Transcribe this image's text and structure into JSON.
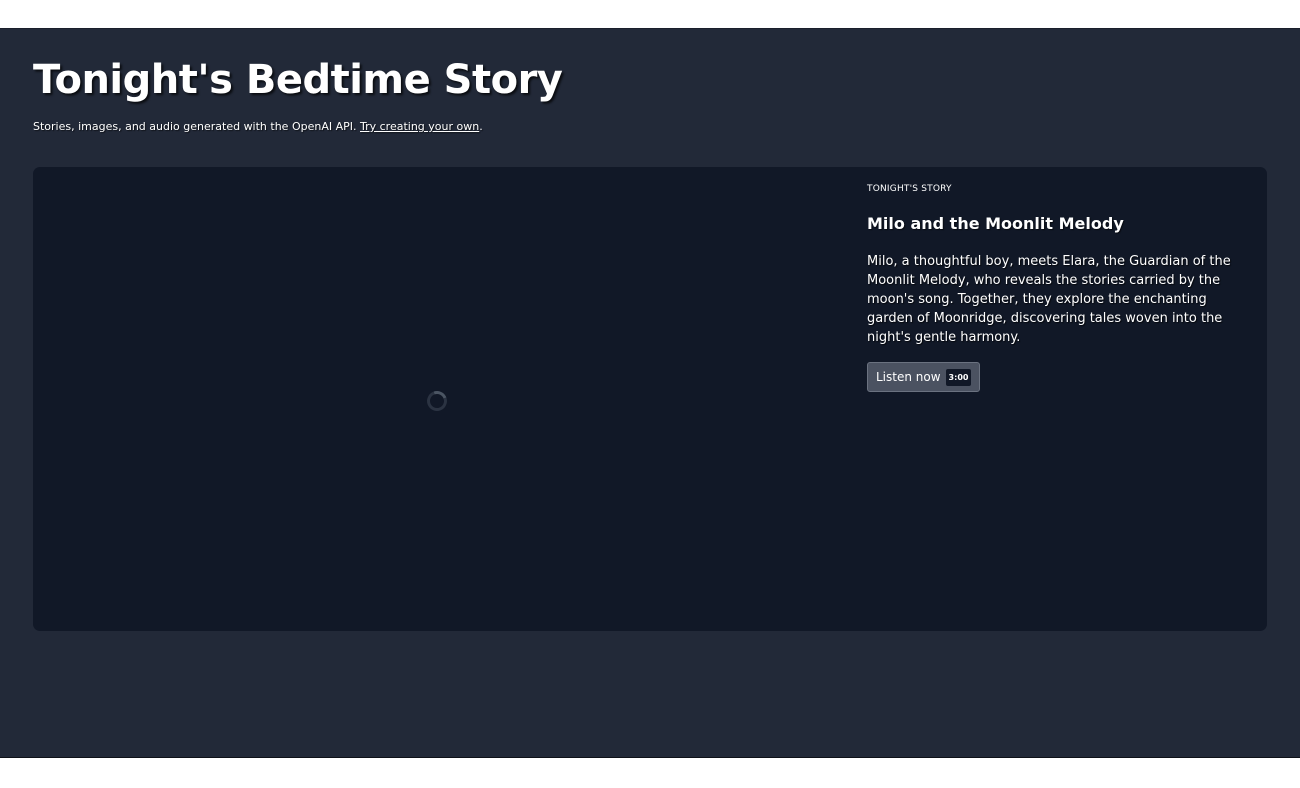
{
  "header": {
    "title": "Tonight's Bedtime Story",
    "subtitle_prefix": "Stories, images, and audio generated with the OpenAI API. ",
    "subtitle_link": "Try creating your own",
    "subtitle_suffix": "."
  },
  "story": {
    "eyebrow": "TONIGHT'S STORY",
    "title": "Milo and the Moonlit Melody",
    "description": "Milo, a thoughtful boy, meets Elara, the Guardian of the Moonlit Melody, who reveals the stories carried by the moon's song. Together, they explore the enchanting garden of Moonridge, discovering tales woven into the night's gentle harmony.",
    "listen_label": "Listen now",
    "duration": "3:00"
  },
  "colors": {
    "page_background": "#222938",
    "card_background": "#111827",
    "button_background": "#4b5261"
  },
  "icons": {
    "loading": "loading-spinner-icon"
  }
}
